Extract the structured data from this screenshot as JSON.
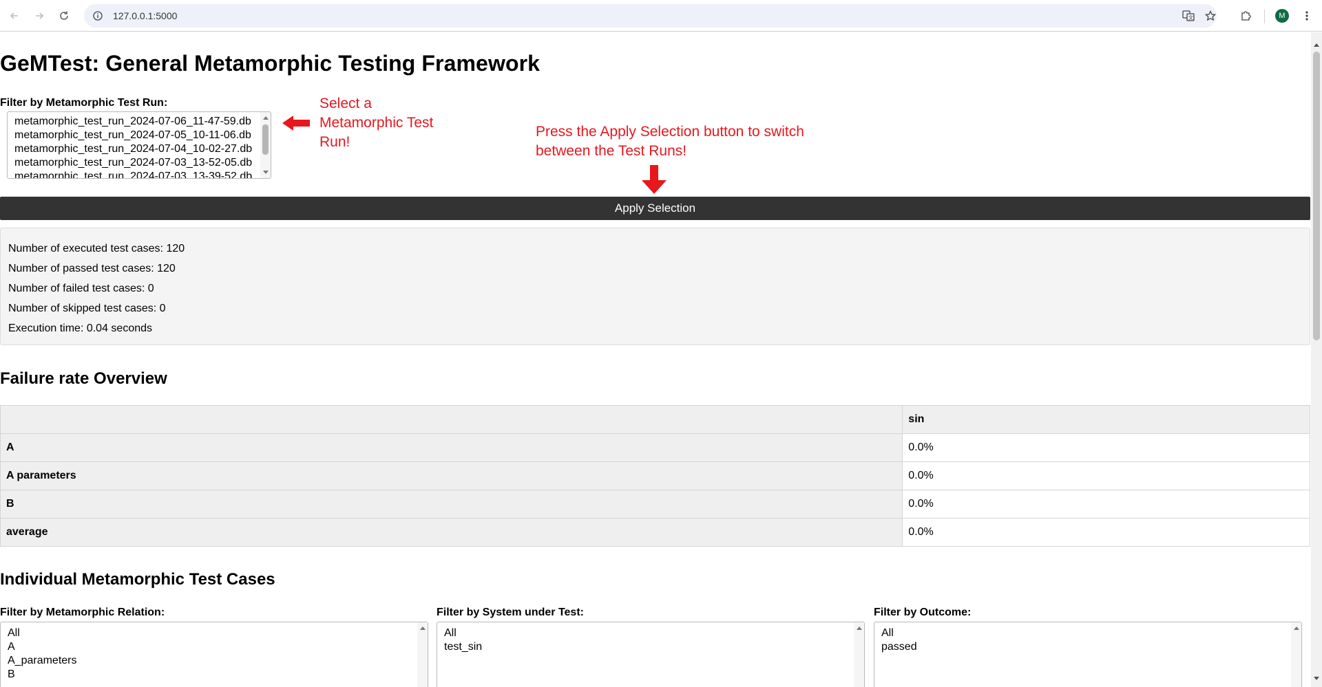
{
  "browser": {
    "url": "127.0.0.1:5000",
    "avatar_letter": "M"
  },
  "page": {
    "title": "GeMTest: General Metamorphic Testing Framework",
    "run_filter": {
      "label": "Filter by Metamorphic Test Run:",
      "options": [
        "metamorphic_test_run_2024-07-06_11-47-59.db",
        "metamorphic_test_run_2024-07-05_10-11-06.db",
        "metamorphic_test_run_2024-07-04_10-02-27.db",
        "metamorphic_test_run_2024-07-03_13-52-05.db",
        "metamorphic_test_run_2024-07-03_13-39-52.db"
      ]
    },
    "annotations": {
      "select_hint": [
        "Select a",
        "Metamorphic Test",
        "Run!"
      ],
      "apply_hint": [
        "Press the Apply Selection button to switch",
        "between the Test Runs!"
      ],
      "accent_color": "#e8161d"
    },
    "apply_button_label": "Apply Selection",
    "stats": {
      "executed": "Number of executed test cases: 120",
      "passed": "Number of passed test cases: 120",
      "failed": "Number of failed test cases: 0",
      "skipped": "Number of skipped test cases: 0",
      "time": "Execution time: 0.04 seconds"
    },
    "failure_overview": {
      "heading": "Failure rate Overview",
      "columns": [
        "",
        "sin"
      ],
      "rows": [
        {
          "label": "A",
          "value": "0.0%"
        },
        {
          "label": "A parameters",
          "value": "0.0%"
        },
        {
          "label": "B",
          "value": "0.0%"
        },
        {
          "label": "average",
          "value": "0.0%"
        }
      ]
    },
    "individual": {
      "heading": "Individual Metamorphic Test Cases",
      "mr_filter": {
        "label": "Filter by Metamorphic Relation:",
        "options": [
          "All",
          "A",
          "A_parameters",
          "B"
        ]
      },
      "sut_filter": {
        "label": "Filter by System under Test:",
        "options": [
          "All",
          "test_sin"
        ]
      },
      "outcome_filter": {
        "label": "Filter by Outcome:",
        "options": [
          "All",
          "passed"
        ]
      }
    }
  }
}
